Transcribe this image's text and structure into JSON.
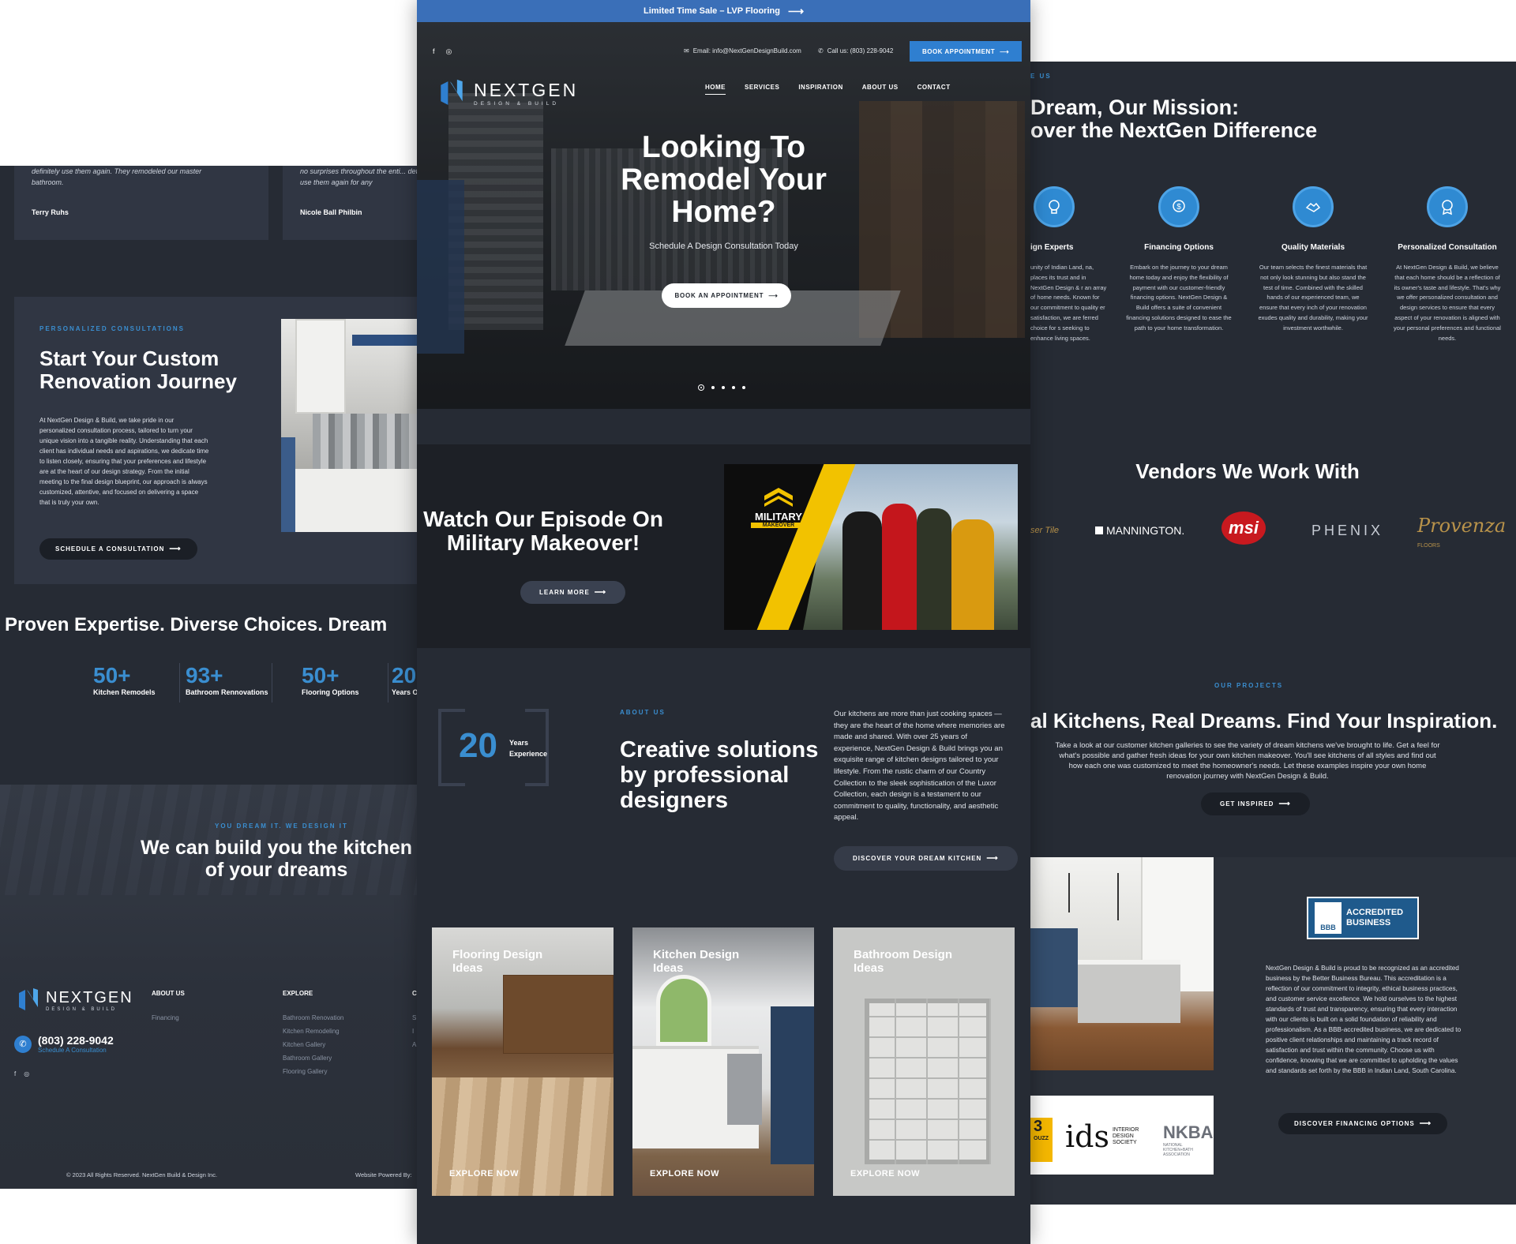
{
  "left": {
    "testimonials": [
      {
        "quote": "definitely use them again. They remodeled our master bathroom.",
        "author": "Terry Ruhs"
      },
      {
        "quote": "no surprises throughout the enti... definitely use them again for any",
        "author": "Nicole Ball Philbin"
      }
    ],
    "consult": {
      "eyebrow": "PERSONALIZED CONSULTATIONS",
      "title_line1": "Start Your Custom",
      "title_line2": "Renovation Journey",
      "body": "At NextGen Design & Build, we take pride in our personalized consultation process, tailored to turn your unique vision into a tangible reality. Understanding that each client has individual needs and aspirations, we dedicate time to listen closely, ensuring that your preferences and lifestyle are at the heart of our design strategy. From the initial meeting to the final design blueprint, our approach is always customized, attentive, and focused on delivering a space that is truly your own.",
      "button": "SCHEDULE A CONSULTATION"
    },
    "expertise_title": "Proven Expertise. Diverse Choices. Dream",
    "stats": [
      {
        "num": "50+",
        "label": "Kitchen Remodels"
      },
      {
        "num": "93+",
        "label": "Bathroom Rennovations"
      },
      {
        "num": "50+",
        "label": "Flooring Options"
      },
      {
        "num": "20",
        "label": "Years O"
      }
    ],
    "kitchen_cta": {
      "eyebrow": "YOU DREAM IT. WE DESIGN IT",
      "title_line1": "We can build you the kitchen",
      "title_line2": "of your dreams"
    },
    "footer": {
      "logo_name": "NEXTGEN",
      "logo_sub": "DESIGN & BUILD",
      "phone": "(803) 228-9042",
      "phone_sub": "Schedule A Consultation",
      "col1_title": "ABOUT US",
      "col1_links": [
        "Financing"
      ],
      "col2_title": "EXPLORE",
      "col2_links": [
        "Bathroom Renovation",
        "Kitchen Remodeling",
        "Kitchen Gallery",
        "Bathroom Gallery",
        "Flooring Gallery"
      ],
      "col3_title": "C",
      "col3_links": [
        "S",
        "I",
        "A"
      ],
      "copyright": "© 2023 All Rights Reserved. NextGen Build & Design Inc.",
      "powered": "Website Powered By:"
    }
  },
  "center": {
    "sale_banner": "Limited Time Sale – LVP Flooring",
    "email": "Email: info@NextGenDesignBuild.com",
    "call": "Call us: (803) 228-9042",
    "book_btn": "BOOK APPOINTMENT",
    "logo_name": "NEXTGEN",
    "logo_sub": "DESIGN & BUILD",
    "nav": [
      "HOME",
      "SERVICES",
      "INSPIRATION",
      "ABOUT US",
      "CONTACT"
    ],
    "hero": {
      "title_line1": "Looking To",
      "title_line2": "Remodel Your",
      "title_line3": "Home?",
      "subtitle": "Schedule A Design Consultation Today",
      "button": "BOOK AN APPOINTMENT"
    },
    "episode": {
      "title_line1": "Watch Our Episode On",
      "title_line2": "Military Makeover!",
      "button": "LEARN MORE",
      "badge_line1": "MILITARY",
      "badge_line2": "MAKEOVER"
    },
    "about": {
      "years_num": "20",
      "years_line1": "Years",
      "years_line2": "Experience",
      "eyebrow": "ABOUT US",
      "title_line1": "Creative solutions",
      "title_line2": "by professional",
      "title_line3": "designers",
      "body": "Our kitchens are more than just cooking spaces — they are the heart of the home where memories are made and shared. With over 25 years of experience, NextGen Design & Build brings you an exquisite range of kitchen designs tailored to your lifestyle. From the rustic charm of our Country Collection to the sleek sophistication of the Luxor Collection, each design is a testament to our commitment to quality, functionality, and aesthetic appeal.",
      "button": "DISCOVER YOUR DREAM KITCHEN"
    },
    "categories": [
      {
        "title": "Flooring Design Ideas",
        "cta": "EXPLORE NOW"
      },
      {
        "title": "Kitchen Design Ideas",
        "cta": "EXPLORE NOW"
      },
      {
        "title": "Bathroom Design Ideas",
        "cta": "EXPLORE NOW"
      }
    ]
  },
  "right": {
    "eyebrow": "E US",
    "title_line1": "Dream, Our Mission:",
    "title_line2": "over the NextGen Difference",
    "features": [
      {
        "title": "ign Experts",
        "icon": "lightbulb-icon",
        "desc": "unity of Indian Land, na, places its trust and in NextGen Design & r an array of home needs. Known for our commitment to quality er satisfaction, we are ferred choice for s seeking to enhance living spaces."
      },
      {
        "title": "Financing Options",
        "icon": "dollar-hand-icon",
        "desc": "Embark on the journey to your dream home today and enjoy the flexibility of payment with our customer-friendly financing options. NextGen Design & Build offers a suite of convenient financing solutions designed to ease the path to your home transformation."
      },
      {
        "title": "Quality Materials",
        "icon": "handshake-icon",
        "desc": "Our team selects the finest materials that not only look stunning but also stand the test of time. Combined with the skilled hands of our experienced team, we ensure that every inch of your renovation exudes quality and durability, making your investment worthwhile."
      },
      {
        "title": "Personalized Consultation",
        "icon": "badge-icon",
        "desc": "At NextGen Design & Build, we believe that each home should be a reflection of its owner's taste and lifestyle. That's why we offer personalized consultation and design services to ensure that every aspect of your renovation is aligned with your personal preferences and functional needs."
      }
    ],
    "vendors_title": "Vendors We Work With",
    "vendors": [
      "ser Tile",
      "MANNINGTON.",
      "msi",
      "PHENIX",
      "Provenza"
    ],
    "vendor_provenza_sub": "FLOORS",
    "projects": {
      "eyebrow": "OUR PROJECTS",
      "title": "al Kitchens, Real Dreams. Find Your Inspiration.",
      "body": "Take a look at our customer kitchen galleries to see the variety of dream kitchens we've brought to life. Get a feel for what's possible and gather fresh ideas for your own kitchen makeover. You'll see kitchens of all styles and find out how each one was customized to meet the homeowner's needs. Let these examples inspire your own home renovation journey with NextGen Design & Build.",
      "button": "GET INSPIRED"
    },
    "bbb": {
      "badge_line1": "ACCREDITED",
      "badge_line2": "BUSINESS",
      "badge_logo": "BBB",
      "body": "NextGen Design & Build is proud to be recognized as an accredited business by the Better Business Bureau. This accreditation is a reflection of our commitment to integrity, ethical business practices, and customer service excellence. We hold ourselves to the highest standards of trust and transparency, ensuring that every interaction with our clients is built on a solid foundation of reliability and professionalism. As a BBB-accredited business, we are dedicated to positive client relationships and maintaining a track record of satisfaction and trust within the community. Choose us with confidence, knowing that we are committed to upholding the values and standards set forth by the BBB in Indian Land, South Carolina.",
      "button": "DISCOVER FINANCING OPTIONS"
    },
    "associations": {
      "houzz": "3",
      "houzz_sub": "OUZZ",
      "ids": "ids",
      "ids_sub": "INTERIOR DESIGN SOCIETY",
      "nkba": "NKBA",
      "nkba_sub": "NATIONAL KITCHEN+BATH ASSOCIATION"
    }
  },
  "colors": {
    "accent": "#3a8ed0",
    "dark_bg": "#262b34",
    "banner": "#3a6fb8"
  }
}
